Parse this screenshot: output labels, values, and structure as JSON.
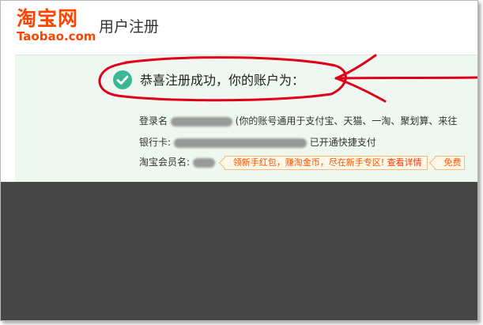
{
  "header": {
    "logo_cn": "淘宝网",
    "logo_en": "Taobao.com",
    "page_title": "用户注册"
  },
  "success": {
    "message": "恭喜注册成功，你的账户为："
  },
  "account": {
    "login_label": "登录名",
    "login_note": "(你的账号通用于支付宝、天猫、一淘、聚划算、来往",
    "bank_label": "银行卡:",
    "bank_status": "已开通快捷支付",
    "member_label": "淘宝会员名:",
    "tip_text": "领新手红包，赚淘金币，尽在新手专区!",
    "tip_link": "查看详情",
    "tip2_text": "免费"
  },
  "colors": {
    "brand": "#ff4400",
    "success_check": "#3ab795",
    "annotation_red": "#e0001a"
  },
  "icons": {
    "success": "check-circle-icon"
  }
}
